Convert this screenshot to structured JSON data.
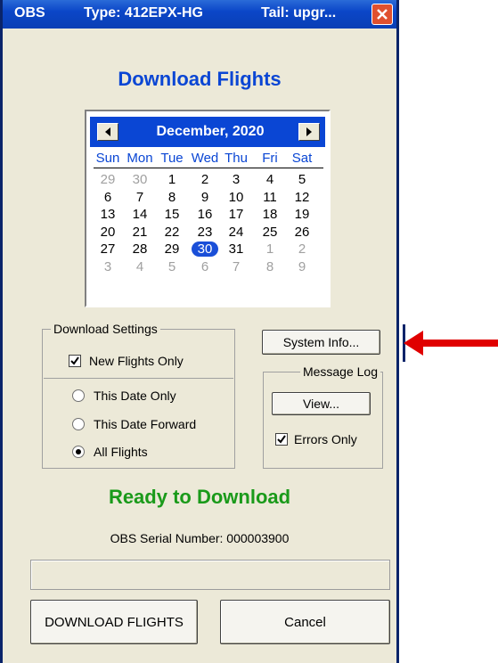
{
  "window": {
    "title_app": "OBS",
    "title_type": "Type: 412EPX-HG",
    "title_tail": "Tail: upgr...",
    "close_icon": "close-icon"
  },
  "heading": "Download Flights",
  "calendar": {
    "month_label": "December, 2020",
    "prev_icon": "triangle-left-icon",
    "next_icon": "triangle-right-icon",
    "weekdays": [
      "Sun",
      "Mon",
      "Tue",
      "Wed",
      "Thu",
      "Fri",
      "Sat"
    ],
    "weeks": [
      [
        "29",
        "30",
        "1",
        "2",
        "3",
        "4",
        "5"
      ],
      [
        "6",
        "7",
        "8",
        "9",
        "10",
        "11",
        "12"
      ],
      [
        "13",
        "14",
        "15",
        "16",
        "17",
        "18",
        "19"
      ],
      [
        "20",
        "21",
        "22",
        "23",
        "24",
        "25",
        "26"
      ],
      [
        "27",
        "28",
        "29",
        "30",
        "31",
        "1",
        "2"
      ],
      [
        "3",
        "4",
        "5",
        "6",
        "7",
        "8",
        "9"
      ]
    ],
    "selected_day": "30"
  },
  "download_settings": {
    "legend": "Download Settings",
    "new_flights_only": "New Flights Only",
    "new_flights_only_checked": true,
    "options": [
      "This Date Only",
      "This Date Forward",
      "All Flights"
    ],
    "selected_option": "All Flights"
  },
  "system_info_button": "System Info...",
  "message_log": {
    "legend": "Message Log",
    "view_button": "View...",
    "errors_only": "Errors Only",
    "errors_only_checked": true
  },
  "status": "Ready to Download",
  "serial": "OBS Serial Number: 000003900",
  "progress": 0,
  "buttons": {
    "download": "DOWNLOAD FLIGHTS",
    "cancel": "Cancel"
  },
  "colors": {
    "title_blue": "#0a46d4",
    "status_green": "#1a9a1a",
    "annotation_arrow": "#e00000"
  }
}
